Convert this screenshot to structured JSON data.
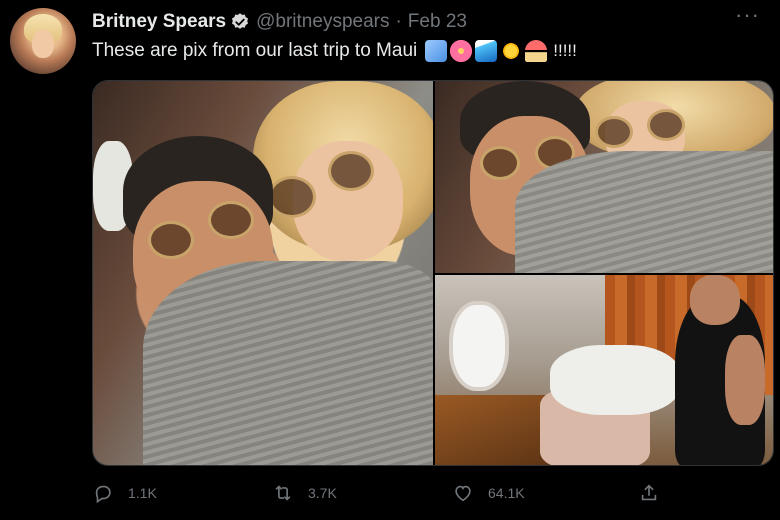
{
  "user": {
    "name": "Britney Spears",
    "handle": "@britneyspears",
    "separator": "·",
    "date": "Feb 23"
  },
  "tweet": {
    "text": "These are pix from our last trip to Maui",
    "emojis": [
      "airplane",
      "hibiscus",
      "water-wave",
      "sun",
      "beach-umbrella"
    ],
    "trailing": "!!!!!"
  },
  "media": {
    "photos": [
      "selfie-close-up",
      "selfie-sweater",
      "plane-cabin"
    ]
  },
  "actions": {
    "reply_count": "1.1K",
    "retweet_count": "3.7K",
    "like_count": "64.1K"
  },
  "colors": {
    "background": "#000000",
    "verified_badge": "#d9d9d9",
    "muted": "#71767b",
    "text": "#e7e9ea"
  }
}
